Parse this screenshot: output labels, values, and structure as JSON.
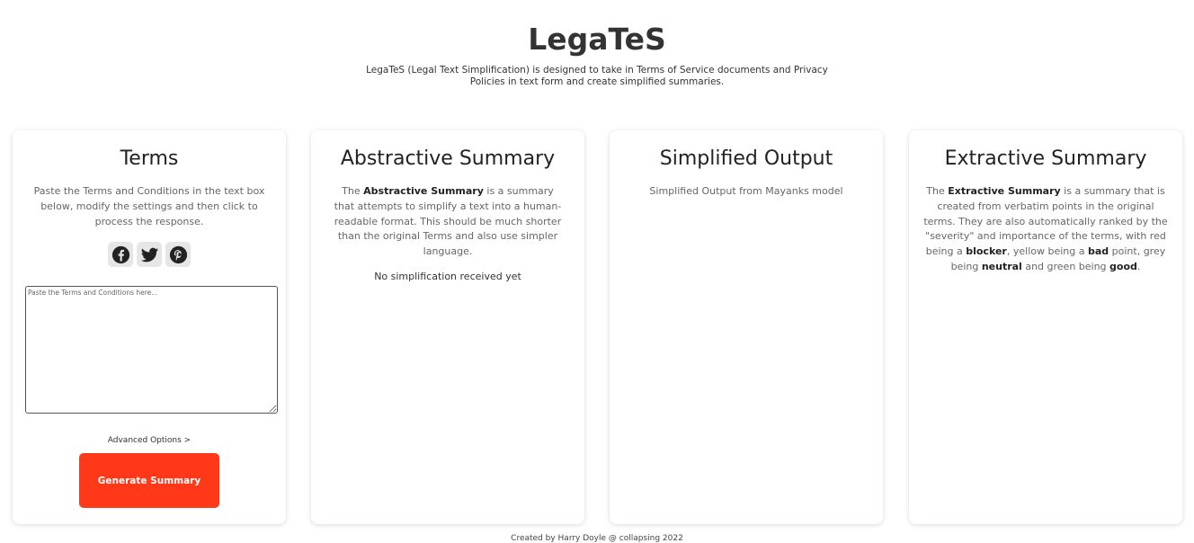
{
  "header": {
    "title": "LegaTeS",
    "description": "LegaTeS (Legal Text Simplification) is designed to take in Terms of Service documents and Privacy Policies in text form and create simplified summaries."
  },
  "terms": {
    "title": "Terms",
    "description": "Paste the Terms and Conditions in the text box below, modify the settings and then click to process the response.",
    "social": [
      "facebook-icon",
      "twitter-icon",
      "pinterest-icon"
    ],
    "input_placeholder": "Paste the Terms and Conditions here...",
    "input_value": "",
    "advanced_label": "Advanced Options >",
    "generate_label": "Generate Summary"
  },
  "abstractive": {
    "title": "Abstractive Summary",
    "desc_prefix": "The ",
    "desc_bold": "Abstractive Summary",
    "desc_suffix": " is a summary that attempts to simplify a text into a human-readable format. This should be much shorter than the original Terms and also use simpler language.",
    "status": "No simplification received yet"
  },
  "simplified": {
    "title": "Simplified Output",
    "description": "Simplified Output from Mayanks model"
  },
  "extractive": {
    "title": "Extractive Summary",
    "d1": "The ",
    "b1": "Extractive Summary",
    "d2": " is a summary that is created from verbatim points in the original terms. They are also automatically ranked by the \"severity\" and importance of the terms, with red being a ",
    "b2": "blocker",
    "d3": ", yellow being a ",
    "b3": "bad",
    "d4": " point, grey being ",
    "b4": "neutral",
    "d5": " and green being ",
    "b5": "good",
    "d6": "."
  },
  "footer": {
    "text": "Created by Harry Doyle @ collapsing 2022"
  },
  "colors": {
    "accent": "#ff3819",
    "card_bg": "#ffffff",
    "text": "#333333"
  }
}
